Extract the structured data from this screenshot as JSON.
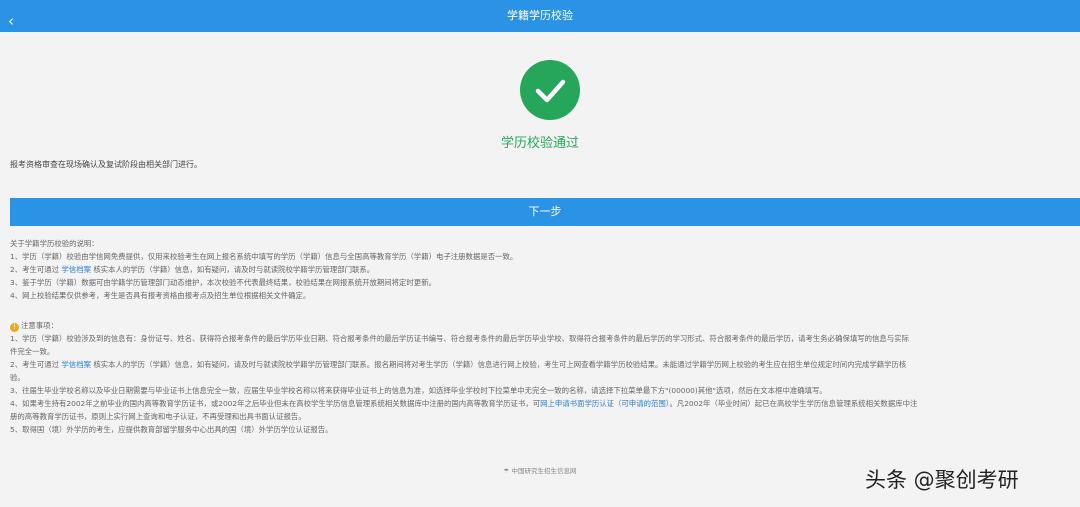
{
  "header": {
    "back_icon": "chevron-left-icon",
    "back_glyph": "‹",
    "title": "学籍学历校验"
  },
  "result": {
    "icon": "check-circle-icon",
    "icon_color": "#26a65b",
    "text": "学历校验通过"
  },
  "top_note": "报考资格审查在现场确认及复试阶段由相关部门进行。",
  "next_button": "下一步",
  "explain": {
    "title": "关于学籍学历校验的说明：",
    "items": [
      {
        "text": "1、学历（学籍）校验由学信网免费提供，仅用来校验考生在网上报名系统中填写的学历（学籍）信息与全国高等教育学历（学籍）电子注册数据是否一致。"
      },
      {
        "before": "2、考生可通过 ",
        "link": "学信档案",
        "after": " 核实本人的学历（学籍）信息，如有疑问，请及时与就读院校学籍学历管理部门联系。"
      },
      {
        "text": "3、鉴于学历（学籍）数据可由学籍学历管理部门动态维护，本次校验不代表最终结果，校验结果在网报系统开放期间将定时更新。"
      },
      {
        "text": "4、网上校验结果仅供参考，考生是否具有报考资格由报考点及招生单位根据相关文件确定。"
      }
    ]
  },
  "notice": {
    "icon": "warning-icon",
    "icon_glyph": "!",
    "title": "注意事项：",
    "item1_line1": "1、学历（学籍）校验涉及到的信息有：身份证号、姓名、获得符合报考条件的最后学历毕业日期、符合报考条件的最后学历证书编号、符合报考条件的最后学历毕业学校、取得符合报考条件的最后学历的学习形式、符合报考条件的最后学历，请考生务必确保填写的信息与实际",
    "item1_line2": "件完全一致。",
    "item2_before": "2、考生可通过 ",
    "item2_link": "学信档案",
    "item2_after": " 核实本人的学历（学籍）信息，如有疑问，请及时与就读院校学籍学历管理部门联系。报名期间将对考生学历（学籍）信息进行网上校验，考生可上网查看学籍学历校验结果。未能通过学籍学历网上校验的考生应在招生单位规定时间内完成学籍学历核",
    "item2_line2": "验。",
    "item3": "3、往届生毕业学校名称以及毕业日期需要与毕业证书上信息完全一致，应届生毕业学校名称以将来获得毕业证书上的信息为准，如选择毕业学校时下拉菜单中无完全一致的名称，请选择下拉菜单最下方\"(00000)其他\"选项，然后在文本框中准确填写。",
    "item4_before": "4、如果考生持有2002年之前毕业的国内高等教育学历证书，或2002年之后毕业但未在高校学生学历信息管理系统相关数据库中注册的国内高等教育学历证书，可",
    "item4_link": "网上申请书面学历认证（可申请的范围）",
    "item4_after": "。凡2002年（毕业时间）起已在高校学生学历信息管理系统相关数据库中注",
    "item4_line2": "册的高等教育学历证书，原则上实行网上查询和电子认证，不再受理和出具书面认证报告。",
    "item5": "5、取得国（境）外学历的考生，应提供教育部留学服务中心出具的国（境）外学历学位认证报告。"
  },
  "footer": {
    "logo_glyph": "☂",
    "text": "中国研究生招生信息网"
  },
  "watermark": "头条 @聚创考研"
}
